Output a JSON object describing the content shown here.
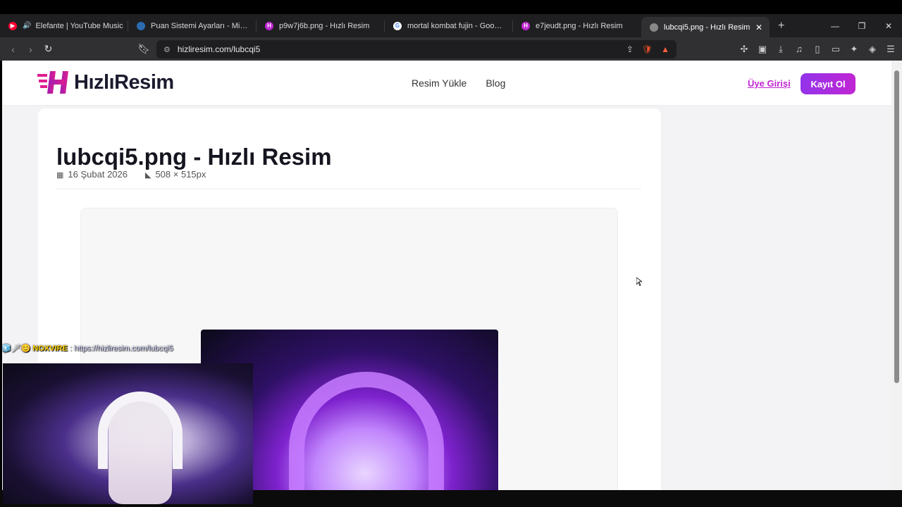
{
  "browser": {
    "tabs": [
      {
        "title": "Elefante | YouTube Music",
        "fav_color": "#ff0033",
        "active": false,
        "audio": true
      },
      {
        "title": "Puan Sistemi Ayarları - MissXss - Kick",
        "fav_color": "#2b6cb0",
        "active": false
      },
      {
        "title": "p9w7j6b.png - Hızlı Resim",
        "fav_color": "#c026d3",
        "active": false
      },
      {
        "title": "mortal kombat fujin - Google'da Ara",
        "fav_color": "#ffffff",
        "active": false
      },
      {
        "title": "e7jeudt.png - Hızlı Resim",
        "fav_color": "#c026d3",
        "active": false
      },
      {
        "title": "lubcqi5.png - Hızlı Resim",
        "fav_color": "#888888",
        "active": true
      }
    ],
    "new_tab": "+",
    "url": "hizliresim.com/lubcqi5"
  },
  "site": {
    "logo_text": "HızlıResim",
    "nav": [
      "Resim Yükle",
      "Blog"
    ],
    "login": "Üye Girişi",
    "signup": "Kayıt Ol"
  },
  "image_page": {
    "title": "lubcqi5.png - Hızlı Resim",
    "date": "16 Şubat 2026",
    "dimensions": "508 × 515px"
  },
  "overlay": {
    "chat_user": "NOXVIRE",
    "chat_message": ": https://hizliresim.com/lubcqi5"
  }
}
